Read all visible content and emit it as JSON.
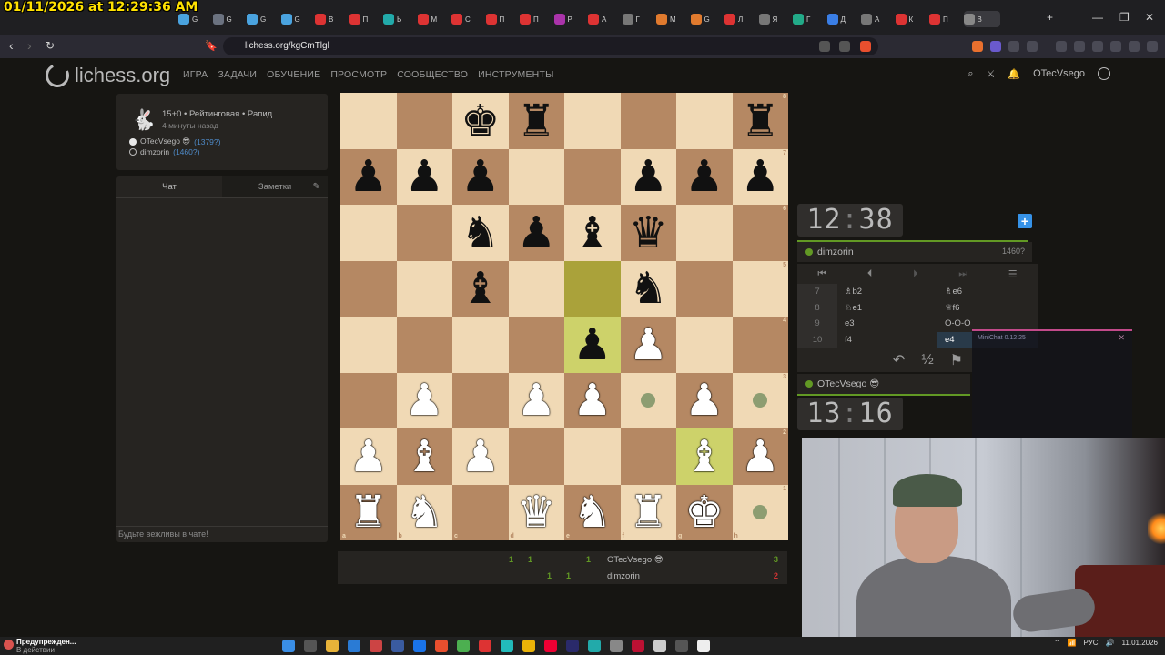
{
  "overlay": {
    "timestamp": "01/11/2026 at 12:29:36 AM"
  },
  "browser": {
    "tab_labels": [
      "G",
      "G",
      "G",
      "G",
      "В",
      "П",
      "Ь",
      "М",
      "С",
      "П",
      "П",
      "Р",
      "А",
      "Г",
      "М",
      "G",
      "Л",
      "Я",
      "Г",
      "Д",
      "А",
      "К",
      "П",
      "В"
    ],
    "url": "lichess.org/kgCmTlgl"
  },
  "site": {
    "logo": "lichess.org",
    "nav": [
      "ИГРА",
      "ЗАДАЧИ",
      "ОБУЧЕНИЕ",
      "ПРОСМОТР",
      "СООБЩЕСТВО",
      "ИНСТРУМЕНТЫ"
    ],
    "user": "OTecVsego"
  },
  "game": {
    "info_line": "15+0 • Рейтинговая • Рапид",
    "time_ago": "4 минуты назад",
    "white": {
      "name": "OTecVsego 😎",
      "rating": "(1379?)"
    },
    "black": {
      "name": "dimzorin",
      "rating": "(1460?)"
    }
  },
  "chat": {
    "tab_chat": "Чат",
    "tab_notes": "Заметки",
    "placeholder": "Будьте вежливы в чате!"
  },
  "board": {
    "rows": [
      [
        "",
        "",
        "bk",
        "br",
        "",
        "",
        "",
        "br"
      ],
      [
        "bp",
        "bp",
        "bp",
        "",
        "",
        "bp",
        "bp",
        "bp"
      ],
      [
        "",
        "",
        "bn",
        "bp",
        "bb",
        "bq",
        "",
        ""
      ],
      [
        "",
        "",
        "bb",
        "",
        "",
        "bn",
        "",
        ""
      ],
      [
        "",
        "",
        "",
        "",
        "bp",
        "wp",
        "",
        ""
      ],
      [
        "",
        "wp",
        "",
        "wp",
        "wp",
        "",
        "wp",
        ""
      ],
      [
        "wp",
        "wb",
        "wp",
        "",
        "",
        "",
        "wb",
        "wp"
      ],
      [
        "wr",
        "wn",
        "",
        "wq",
        "wn",
        "wr",
        "wk",
        ""
      ]
    ],
    "highlights": [
      "e5",
      "e4"
    ],
    "selected": "g2",
    "dots": [
      "f3",
      "h3",
      "h1"
    ],
    "files": [
      "a",
      "b",
      "c",
      "d",
      "e",
      "f",
      "g",
      "h"
    ],
    "ranks": [
      "8",
      "7",
      "6",
      "5",
      "4",
      "3",
      "2",
      "1"
    ]
  },
  "clocks": {
    "top": {
      "mm": "12",
      "ss": "38"
    },
    "bottom": {
      "mm": "13",
      "ss": "16"
    }
  },
  "opponent": {
    "name": "dimzorin",
    "rating": "1460?"
  },
  "player": {
    "name": "OTecVsego 😎"
  },
  "moves": [
    {
      "n": "7",
      "w": "♗b2",
      "b": "♗e6"
    },
    {
      "n": "8",
      "w": "♘e1",
      "b": "♕f6"
    },
    {
      "n": "9",
      "w": "e3",
      "b": "O-O-O"
    },
    {
      "n": "10",
      "w": "f4",
      "b": "e4"
    }
  ],
  "minichat": {
    "title": "MiniChat 0.12.25"
  },
  "score": {
    "white": {
      "name": "OTecVsego 😎",
      "points": [
        "1",
        "1",
        "1"
      ],
      "total": "3"
    },
    "black": {
      "name": "dimzorin",
      "points": [
        "1",
        "1"
      ],
      "total": "2"
    }
  },
  "taskbar": {
    "alert_title": "Предупрежден...",
    "alert_sub": "В действии",
    "lang": "РУС",
    "date": "11.01.2026"
  },
  "colors": {
    "accent_green": "#629924",
    "blue": "#3692e7",
    "timestamp_yellow": "#ffe100"
  }
}
